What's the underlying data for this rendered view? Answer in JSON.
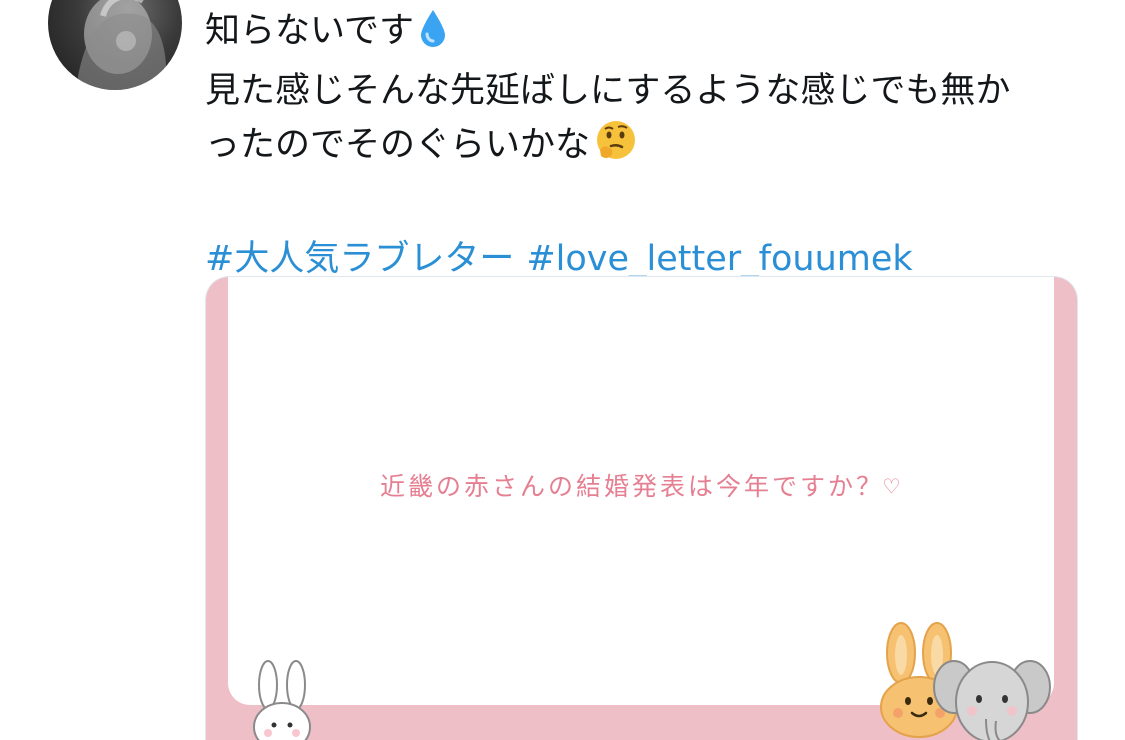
{
  "tweet": {
    "lines": [
      "知らないです",
      "見た感じそんな先延ばしにするような感じでも無か",
      "ったのでそのぐらいかな"
    ],
    "line1_emoji": "droplet-emoji",
    "line3_emoji": "thinking-face-emoji",
    "hashtags": [
      "#大人気ラブレター",
      "#love_letter_fouumek"
    ]
  },
  "card": {
    "message": "近畿の赤さんの結婚発表は今年ですか？♡",
    "icons": [
      "white-rabbit-icon",
      "orange-rabbit-icon",
      "elephant-icon"
    ]
  },
  "colors": {
    "text": "#14171a",
    "link": "#2b8fd6",
    "card_frame": "#efbfc8",
    "card_text": "#e57f91"
  }
}
